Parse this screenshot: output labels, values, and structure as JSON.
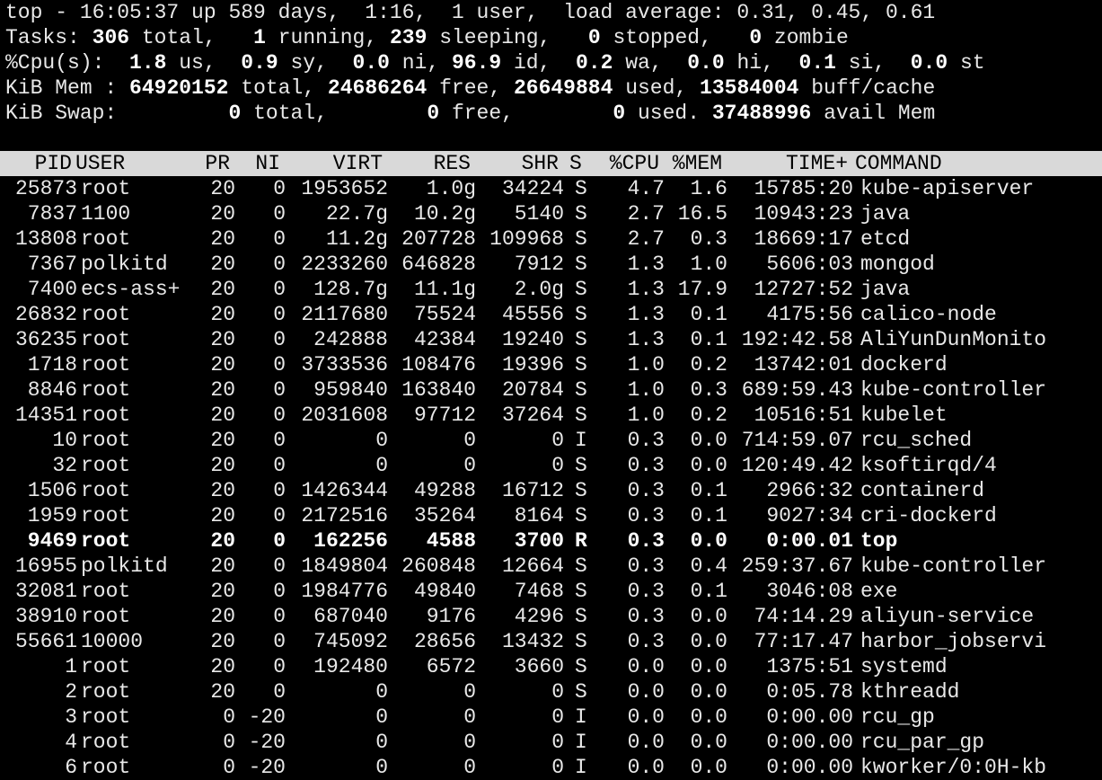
{
  "summary": {
    "line1": "top - 16:05:37 up 589 days,  1:16,  1 user,  load average: 0.31, 0.45, 0.61",
    "tasks": {
      "label": "Tasks:",
      "total": "306",
      "total_label": " total,",
      "running": "1",
      "running_label": " running,",
      "sleeping": "239",
      "sleeping_label": " sleeping,",
      "stopped": "0",
      "stopped_label": " stopped,",
      "zombie": "0",
      "zombie_label": " zombie"
    },
    "cpu": {
      "label": "%Cpu(s):",
      "us": "1.8",
      "us_label": " us,",
      "sy": "0.9",
      "sy_label": " sy,",
      "ni": "0.0",
      "ni_label": " ni,",
      "id": "96.9",
      "id_label": " id,",
      "wa": "0.2",
      "wa_label": " wa,",
      "hi": "0.0",
      "hi_label": " hi,",
      "si": "0.1",
      "si_label": " si,",
      "st": "0.0",
      "st_label": " st"
    },
    "mem": {
      "label": "KiB Mem :",
      "total": "64920152",
      "total_label": " total,",
      "free": "24686264",
      "free_label": " free,",
      "used": "26649884",
      "used_label": " used,",
      "cache": "13584004",
      "cache_label": " buff/cache"
    },
    "swap": {
      "label": "KiB Swap:",
      "total": "0",
      "total_label": " total,",
      "free": "0",
      "free_label": " free,",
      "used": "0",
      "used_label": " used.",
      "avail": "37488996",
      "avail_label": " avail Mem"
    }
  },
  "columns": {
    "pid": "PID",
    "user": "USER",
    "pr": "PR",
    "ni": "NI",
    "virt": "VIRT",
    "res": "RES",
    "shr": "SHR",
    "s": "S",
    "cpu": "%CPU",
    "mem": "%MEM",
    "time": "TIME+",
    "command": "COMMAND"
  },
  "processes": [
    {
      "pid": "25873",
      "user": "root",
      "pr": "20",
      "ni": "0",
      "virt": "1953652",
      "res": "1.0g",
      "shr": "34224",
      "s": "S",
      "cpu": "4.7",
      "mem": "1.6",
      "time": "15785:20",
      "command": "kube-apiserver"
    },
    {
      "pid": "7837",
      "user": "1100",
      "pr": "20",
      "ni": "0",
      "virt": "22.7g",
      "res": "10.2g",
      "shr": "5140",
      "s": "S",
      "cpu": "2.7",
      "mem": "16.5",
      "time": "10943:23",
      "command": "java"
    },
    {
      "pid": "13808",
      "user": "root",
      "pr": "20",
      "ni": "0",
      "virt": "11.2g",
      "res": "207728",
      "shr": "109968",
      "s": "S",
      "cpu": "2.7",
      "mem": "0.3",
      "time": "18669:17",
      "command": "etcd"
    },
    {
      "pid": "7367",
      "user": "polkitd",
      "pr": "20",
      "ni": "0",
      "virt": "2233260",
      "res": "646828",
      "shr": "7912",
      "s": "S",
      "cpu": "1.3",
      "mem": "1.0",
      "time": "5606:03",
      "command": "mongod"
    },
    {
      "pid": "7400",
      "user": "ecs-ass+",
      "pr": "20",
      "ni": "0",
      "virt": "128.7g",
      "res": "11.1g",
      "shr": "2.0g",
      "s": "S",
      "cpu": "1.3",
      "mem": "17.9",
      "time": "12727:52",
      "command": "java"
    },
    {
      "pid": "26832",
      "user": "root",
      "pr": "20",
      "ni": "0",
      "virt": "2117680",
      "res": "75524",
      "shr": "45556",
      "s": "S",
      "cpu": "1.3",
      "mem": "0.1",
      "time": "4175:56",
      "command": "calico-node"
    },
    {
      "pid": "36235",
      "user": "root",
      "pr": "20",
      "ni": "0",
      "virt": "242888",
      "res": "42384",
      "shr": "19240",
      "s": "S",
      "cpu": "1.3",
      "mem": "0.1",
      "time": "192:42.58",
      "command": "AliYunDunMonito"
    },
    {
      "pid": "1718",
      "user": "root",
      "pr": "20",
      "ni": "0",
      "virt": "3733536",
      "res": "108476",
      "shr": "19396",
      "s": "S",
      "cpu": "1.0",
      "mem": "0.2",
      "time": "13742:01",
      "command": "dockerd"
    },
    {
      "pid": "8846",
      "user": "root",
      "pr": "20",
      "ni": "0",
      "virt": "959840",
      "res": "163840",
      "shr": "20784",
      "s": "S",
      "cpu": "1.0",
      "mem": "0.3",
      "time": "689:59.43",
      "command": "kube-controller"
    },
    {
      "pid": "14351",
      "user": "root",
      "pr": "20",
      "ni": "0",
      "virt": "2031608",
      "res": "97712",
      "shr": "37264",
      "s": "S",
      "cpu": "1.0",
      "mem": "0.2",
      "time": "10516:51",
      "command": "kubelet"
    },
    {
      "pid": "10",
      "user": "root",
      "pr": "20",
      "ni": "0",
      "virt": "0",
      "res": "0",
      "shr": "0",
      "s": "I",
      "cpu": "0.3",
      "mem": "0.0",
      "time": "714:59.07",
      "command": "rcu_sched"
    },
    {
      "pid": "32",
      "user": "root",
      "pr": "20",
      "ni": "0",
      "virt": "0",
      "res": "0",
      "shr": "0",
      "s": "S",
      "cpu": "0.3",
      "mem": "0.0",
      "time": "120:49.42",
      "command": "ksoftirqd/4"
    },
    {
      "pid": "1506",
      "user": "root",
      "pr": "20",
      "ni": "0",
      "virt": "1426344",
      "res": "49288",
      "shr": "16712",
      "s": "S",
      "cpu": "0.3",
      "mem": "0.1",
      "time": "2966:32",
      "command": "containerd"
    },
    {
      "pid": "1959",
      "user": "root",
      "pr": "20",
      "ni": "0",
      "virt": "2172516",
      "res": "35264",
      "shr": "8164",
      "s": "S",
      "cpu": "0.3",
      "mem": "0.1",
      "time": "9027:34",
      "command": "cri-dockerd"
    },
    {
      "pid": "9469",
      "user": "root",
      "pr": "20",
      "ni": "0",
      "virt": "162256",
      "res": "4588",
      "shr": "3700",
      "s": "R",
      "cpu": "0.3",
      "mem": "0.0",
      "time": "0:00.01",
      "command": "top",
      "bold": true
    },
    {
      "pid": "16955",
      "user": "polkitd",
      "pr": "20",
      "ni": "0",
      "virt": "1849804",
      "res": "260848",
      "shr": "12664",
      "s": "S",
      "cpu": "0.3",
      "mem": "0.4",
      "time": "259:37.67",
      "command": "kube-controller"
    },
    {
      "pid": "32081",
      "user": "root",
      "pr": "20",
      "ni": "0",
      "virt": "1984776",
      "res": "49840",
      "shr": "7468",
      "s": "S",
      "cpu": "0.3",
      "mem": "0.1",
      "time": "3046:08",
      "command": "exe"
    },
    {
      "pid": "38910",
      "user": "root",
      "pr": "20",
      "ni": "0",
      "virt": "687040",
      "res": "9176",
      "shr": "4296",
      "s": "S",
      "cpu": "0.3",
      "mem": "0.0",
      "time": "74:14.29",
      "command": "aliyun-service"
    },
    {
      "pid": "55661",
      "user": "10000",
      "pr": "20",
      "ni": "0",
      "virt": "745092",
      "res": "28656",
      "shr": "13432",
      "s": "S",
      "cpu": "0.3",
      "mem": "0.0",
      "time": "77:17.47",
      "command": "harbor_jobservi"
    },
    {
      "pid": "1",
      "user": "root",
      "pr": "20",
      "ni": "0",
      "virt": "192480",
      "res": "6572",
      "shr": "3660",
      "s": "S",
      "cpu": "0.0",
      "mem": "0.0",
      "time": "1375:51",
      "command": "systemd"
    },
    {
      "pid": "2",
      "user": "root",
      "pr": "20",
      "ni": "0",
      "virt": "0",
      "res": "0",
      "shr": "0",
      "s": "S",
      "cpu": "0.0",
      "mem": "0.0",
      "time": "0:05.78",
      "command": "kthreadd"
    },
    {
      "pid": "3",
      "user": "root",
      "pr": "0",
      "ni": "-20",
      "virt": "0",
      "res": "0",
      "shr": "0",
      "s": "I",
      "cpu": "0.0",
      "mem": "0.0",
      "time": "0:00.00",
      "command": "rcu_gp"
    },
    {
      "pid": "4",
      "user": "root",
      "pr": "0",
      "ni": "-20",
      "virt": "0",
      "res": "0",
      "shr": "0",
      "s": "I",
      "cpu": "0.0",
      "mem": "0.0",
      "time": "0:00.00",
      "command": "rcu_par_gp"
    },
    {
      "pid": "6",
      "user": "root",
      "pr": "0",
      "ni": "-20",
      "virt": "0",
      "res": "0",
      "shr": "0",
      "s": "I",
      "cpu": "0.0",
      "mem": "0.0",
      "time": "0:00.00",
      "command": "kworker/0:0H-kb"
    }
  ]
}
